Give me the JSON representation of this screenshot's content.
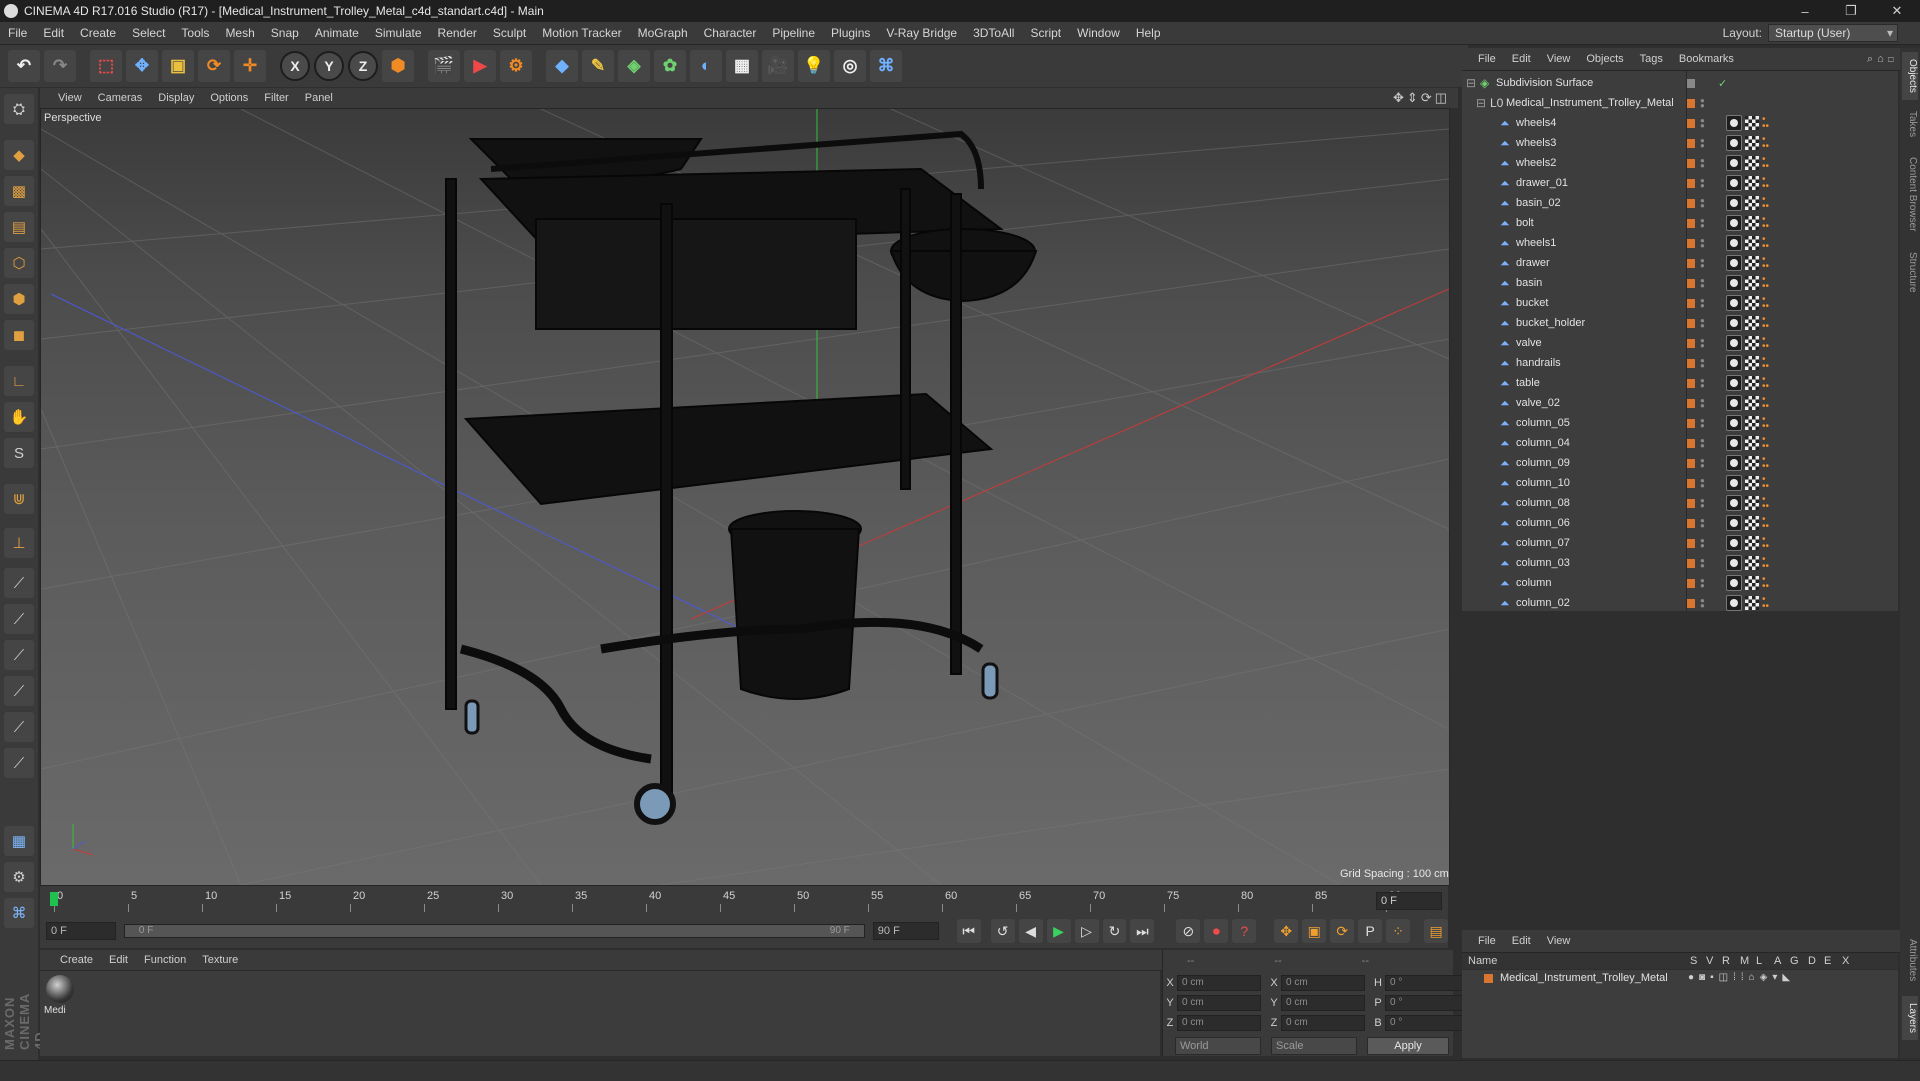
{
  "window": {
    "title": "CINEMA 4D R17.016 Studio (R17) - [Medical_Instrument_Trolley_Metal_c4d_standart.c4d] - Main",
    "controls": [
      "–",
      "❐",
      "✕"
    ]
  },
  "menubar": {
    "items": [
      "File",
      "Edit",
      "Create",
      "Select",
      "Tools",
      "Mesh",
      "Snap",
      "Animate",
      "Simulate",
      "Render",
      "Sculpt",
      "Motion Tracker",
      "MoGraph",
      "Character",
      "Pipeline",
      "Plugins",
      "V-Ray Bridge",
      "3DToAll",
      "Script",
      "Window",
      "Help"
    ],
    "layout_label": "Layout:",
    "layout_value": "Startup (User)"
  },
  "viewport": {
    "menu": [
      "View",
      "Cameras",
      "Display",
      "Options",
      "Filter",
      "Panel"
    ],
    "label": "Perspective",
    "grid_spacing": "Grid Spacing : 100 cm"
  },
  "timeline": {
    "ticks": [
      0,
      5,
      10,
      15,
      20,
      25,
      30,
      35,
      40,
      45,
      50,
      55,
      60,
      65,
      70,
      75,
      80,
      85,
      90
    ],
    "current_frame": "0 F"
  },
  "transport": {
    "start_field": "0 F",
    "range_start": "0 F",
    "range_end": "90 F",
    "end_field": "90 F"
  },
  "material_manager": {
    "menu": [
      "Create",
      "Edit",
      "Function",
      "Texture"
    ],
    "material_label": "Medi"
  },
  "coordinates": {
    "header": [
      "--",
      "--",
      "--"
    ],
    "rows": [
      {
        "l1": "X",
        "v1": "0 cm",
        "l2": "X",
        "v2": "0 cm",
        "l3": "H",
        "v3": "0 °"
      },
      {
        "l1": "Y",
        "v1": "0 cm",
        "l2": "Y",
        "v2": "0 cm",
        "l3": "P",
        "v3": "0 °"
      },
      {
        "l1": "Z",
        "v1": "0 cm",
        "l2": "Z",
        "v2": "0 cm",
        "l3": "B",
        "v3": "0 °"
      }
    ],
    "mode": "World",
    "type": "Scale",
    "apply": "Apply"
  },
  "object_manager": {
    "menu": [
      "File",
      "Edit",
      "View",
      "Objects",
      "Tags",
      "Bookmarks"
    ],
    "root": "Subdivision Surface",
    "group": "Medical_Instrument_Trolley_Metal",
    "objects": [
      "wheels4",
      "wheels3",
      "wheels2",
      "drawer_01",
      "basin_02",
      "bolt",
      "wheels1",
      "drawer",
      "basin",
      "bucket",
      "bucket_holder",
      "valve",
      "handrails",
      "table",
      "valve_02",
      "column_05",
      "column_04",
      "column_09",
      "column_10",
      "column_08",
      "column_06",
      "column_07",
      "column_03",
      "column",
      "column_02"
    ]
  },
  "layer_manager": {
    "menu": [
      "File",
      "Edit",
      "View"
    ],
    "headers": [
      "Name",
      "S",
      "V",
      "R",
      "M",
      "L",
      "A",
      "G",
      "D",
      "E",
      "X"
    ],
    "layer": "Medical_Instrument_Trolley_Metal"
  },
  "right_tabs": [
    "Objects",
    "Takes",
    "Content Browser",
    "Structure",
    "Attributes",
    "Layers"
  ],
  "colors": {
    "accent_orange": "#d8752e",
    "play_green": "#3ad060",
    "record_red": "#f04a4a",
    "axis_x": "#c83a3a",
    "axis_y": "#3ac03a",
    "axis_z": "#4a5ad8"
  }
}
